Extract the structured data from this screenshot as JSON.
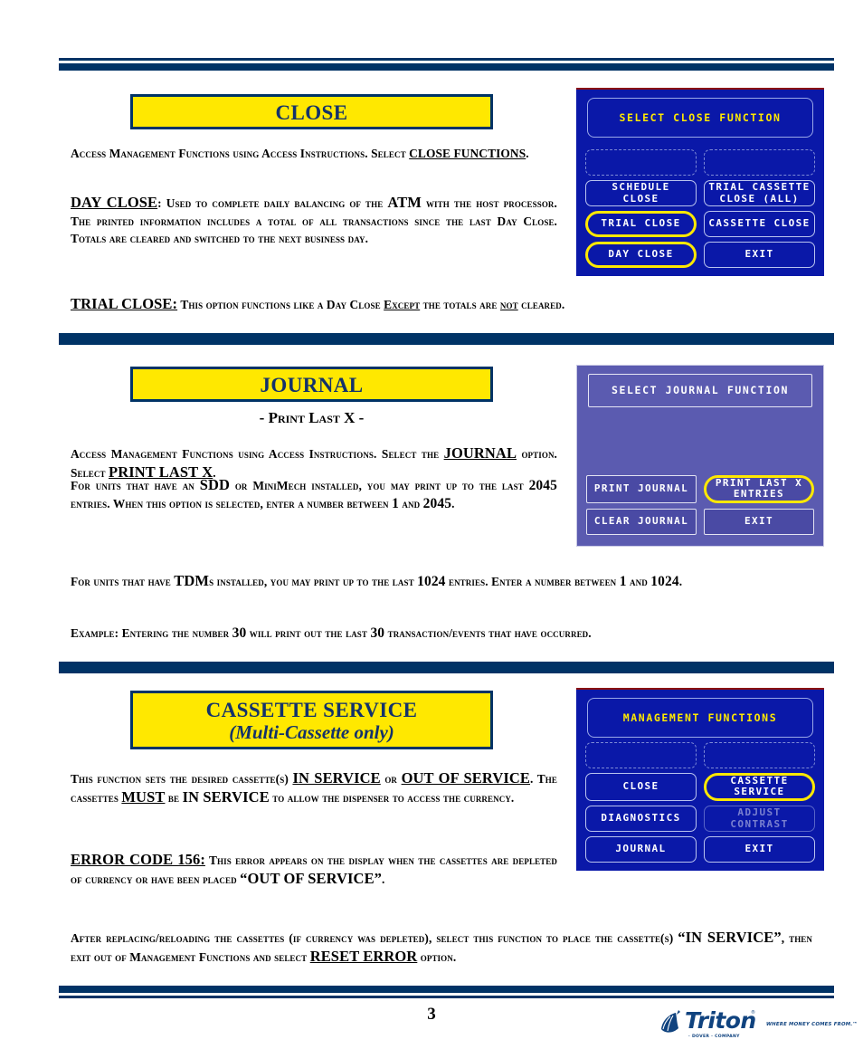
{
  "page": {
    "number": "3",
    "accent_navy": "#003366",
    "banner_yellow": "#ffe800",
    "banner_text_color": "#13326b"
  },
  "sections": [
    {
      "id": "close",
      "banner_title": "CLOSE",
      "paragraphs": [
        {
          "id": "close-intro",
          "runs": [
            {
              "t": "Access Management Functions using Access Instructions.  Select ",
              "style": "sc"
            },
            {
              "t": "CLOSE FUNCTIONS",
              "style": "sc-underline"
            },
            {
              "t": ".",
              "style": "sc"
            }
          ]
        },
        {
          "id": "close-day",
          "runs": [
            {
              "t": "DAY CLOSE",
              "style": "sc-underline-big"
            },
            {
              "t": ":  Used to complete daily balancing of the ",
              "style": "sc"
            },
            {
              "t": "ATM",
              "style": "caps-big"
            },
            {
              "t": " with the host processor.  The printed information includes a total of all transactions since the last Day Close.  Totals are cleared and switched to the next business day.",
              "style": "sc"
            }
          ]
        },
        {
          "id": "close-trial",
          "runs": [
            {
              "t": "TRIAL CLOSE:",
              "style": "sc-underline-big"
            },
            {
              "t": "  This option functions like a Day Close ",
              "style": "sc"
            },
            {
              "t": "Except",
              "style": "sc-underline"
            },
            {
              "t": " the totals are ",
              "style": "sc"
            },
            {
              "t": "not",
              "style": "sc-underline"
            },
            {
              "t": " cleared.",
              "style": "sc"
            }
          ]
        }
      ],
      "screen": {
        "style": "navy",
        "title": "SELECT CLOSE FUNCTION",
        "buttons": [
          {
            "label": "",
            "blank": true,
            "highlight": false,
            "dimmed": false
          },
          {
            "label": "",
            "blank": true,
            "highlight": false,
            "dimmed": false
          },
          {
            "label": "SCHEDULE\nCLOSE",
            "blank": false,
            "highlight": false,
            "dimmed": false
          },
          {
            "label": "TRIAL CASSETTE\nCLOSE (ALL)",
            "blank": false,
            "highlight": false,
            "dimmed": false
          },
          {
            "label": "TRIAL CLOSE",
            "blank": false,
            "highlight": true,
            "dimmed": false
          },
          {
            "label": "CASSETTE CLOSE",
            "blank": false,
            "highlight": false,
            "dimmed": false
          },
          {
            "label": "DAY CLOSE",
            "blank": false,
            "highlight": true,
            "dimmed": false
          },
          {
            "label": "EXIT",
            "blank": false,
            "highlight": false,
            "dimmed": false
          }
        ]
      }
    },
    {
      "id": "journal",
      "banner_title": "JOURNAL",
      "subtitle": "- Print Last X -",
      "paragraphs": [
        {
          "id": "journal-intro",
          "runs": [
            {
              "t": "Access Management Functions using Access Instructions.  Select the ",
              "style": "sc"
            },
            {
              "t": "JOURNAL",
              "style": "sc-underline-big"
            },
            {
              "t": " option.  Select ",
              "style": "sc"
            },
            {
              "t": "PRINT LAST X",
              "style": "sc-underline-big"
            },
            {
              "t": ".",
              "style": "sc"
            }
          ]
        },
        {
          "id": "journal-sdd",
          "runs": [
            {
              "t": "For units that have an ",
              "style": "sc"
            },
            {
              "t": "SDD",
              "style": "caps-big"
            },
            {
              "t": " or MiniMech installed, you may print up to the last ",
              "style": "sc"
            },
            {
              "t": "2045",
              "style": "num"
            },
            {
              "t": " entries.  When this option is selected, enter a number between ",
              "style": "sc"
            },
            {
              "t": "1",
              "style": "num"
            },
            {
              "t": " and ",
              "style": "sc"
            },
            {
              "t": "2045",
              "style": "num"
            },
            {
              "t": ".",
              "style": "sc"
            }
          ]
        },
        {
          "id": "journal-tdm",
          "runs": [
            {
              "t": "For units that have ",
              "style": "sc"
            },
            {
              "t": "TDM",
              "style": "caps-big"
            },
            {
              "t": "s installed, you may print up to the last ",
              "style": "sc"
            },
            {
              "t": "1024",
              "style": "num"
            },
            {
              "t": " entries.  Enter a number between ",
              "style": "sc"
            },
            {
              "t": "1",
              "style": "num"
            },
            {
              "t": " and ",
              "style": "sc"
            },
            {
              "t": "1024",
              "style": "num"
            },
            {
              "t": ".",
              "style": "sc"
            }
          ]
        },
        {
          "id": "journal-example",
          "runs": [
            {
              "t": "Example:  Entering the number ",
              "style": "sc"
            },
            {
              "t": "30",
              "style": "num"
            },
            {
              "t": " will print out the last ",
              "style": "sc"
            },
            {
              "t": "30",
              "style": "num"
            },
            {
              "t": " transaction/events that have occurred.",
              "style": "sc"
            }
          ]
        }
      ],
      "screen": {
        "style": "violet",
        "title": "SELECT JOURNAL FUNCTION",
        "buttons": [
          {
            "label": "",
            "blank": true,
            "highlight": false,
            "dimmed": false
          },
          {
            "label": "",
            "blank": true,
            "highlight": false,
            "dimmed": false
          },
          {
            "label": "",
            "blank": true,
            "highlight": false,
            "dimmed": false
          },
          {
            "label": "",
            "blank": true,
            "highlight": false,
            "dimmed": false
          },
          {
            "label": "PRINT JOURNAL",
            "blank": false,
            "highlight": false,
            "dimmed": false
          },
          {
            "label": "PRINT LAST X\nENTRIES",
            "blank": false,
            "highlight": true,
            "dimmed": false
          },
          {
            "label": "CLEAR JOURNAL",
            "blank": false,
            "highlight": false,
            "dimmed": false
          },
          {
            "label": "EXIT",
            "blank": false,
            "highlight": false,
            "dimmed": false
          }
        ]
      }
    },
    {
      "id": "cassette",
      "banner_title": "CASSETTE SERVICE",
      "banner_subtitle": "(Multi-Cassette only)",
      "paragraphs": [
        {
          "id": "cassette-intro",
          "runs": [
            {
              "t": "This function sets the desired cassette(s) ",
              "style": "sc"
            },
            {
              "t": "IN SERVICE",
              "style": "caps-big-underline"
            },
            {
              "t": " or ",
              "style": "sc"
            },
            {
              "t": "OUT OF SERVICE",
              "style": "caps-big-underline"
            },
            {
              "t": ".  The cassettes ",
              "style": "sc"
            },
            {
              "t": "MUST",
              "style": "caps-big-underline"
            },
            {
              "t": " be ",
              "style": "sc"
            },
            {
              "t": "IN SERVICE",
              "style": "caps-big"
            },
            {
              "t": " to allow the dispenser to access the currency.",
              "style": "sc"
            }
          ]
        },
        {
          "id": "cassette-error",
          "runs": [
            {
              "t": "ERROR CODE 156:",
              "style": "caps-big-underline"
            },
            {
              "t": "  This error appears on the display when the cassettes are depleted of currency or have been placed ",
              "style": "sc"
            },
            {
              "t": "“OUT OF SERVICE”",
              "style": "caps-big"
            },
            {
              "t": ".",
              "style": "sc"
            }
          ]
        },
        {
          "id": "cassette-after",
          "runs": [
            {
              "t": "After replacing/reloading the cassettes (if currency was depleted), select this function to place the cassette(s) ",
              "style": "sc"
            },
            {
              "t": "“IN SERVICE”",
              "style": "caps-big"
            },
            {
              "t": ", then exit out of Management Functions and select ",
              "style": "sc"
            },
            {
              "t": "RESET ERROR",
              "style": "caps-big-underline"
            },
            {
              "t": " option.",
              "style": "sc"
            }
          ]
        }
      ],
      "screen": {
        "style": "navy",
        "title": "MANAGEMENT FUNCTIONS",
        "buttons": [
          {
            "label": "",
            "blank": true,
            "highlight": false,
            "dimmed": false
          },
          {
            "label": "",
            "blank": true,
            "highlight": false,
            "dimmed": false
          },
          {
            "label": "CLOSE",
            "blank": false,
            "highlight": false,
            "dimmed": false
          },
          {
            "label": "CASSETTE\nSERVICE",
            "blank": false,
            "highlight": true,
            "dimmed": false
          },
          {
            "label": "DIAGNOSTICS",
            "blank": false,
            "highlight": false,
            "dimmed": false
          },
          {
            "label": "ADJUST\nCONTRAST",
            "blank": false,
            "highlight": false,
            "dimmed": true
          },
          {
            "label": "JOURNAL",
            "blank": false,
            "highlight": false,
            "dimmed": false
          },
          {
            "label": "EXIT",
            "blank": false,
            "highlight": false,
            "dimmed": false
          }
        ]
      }
    }
  ],
  "footer": {
    "logo_wordmark": "Triton",
    "logo_tagline": "WHERE MONEY COMES FROM.™",
    "logo_sub": "· DOVER · COMPANY",
    "registered_mark": "®"
  }
}
